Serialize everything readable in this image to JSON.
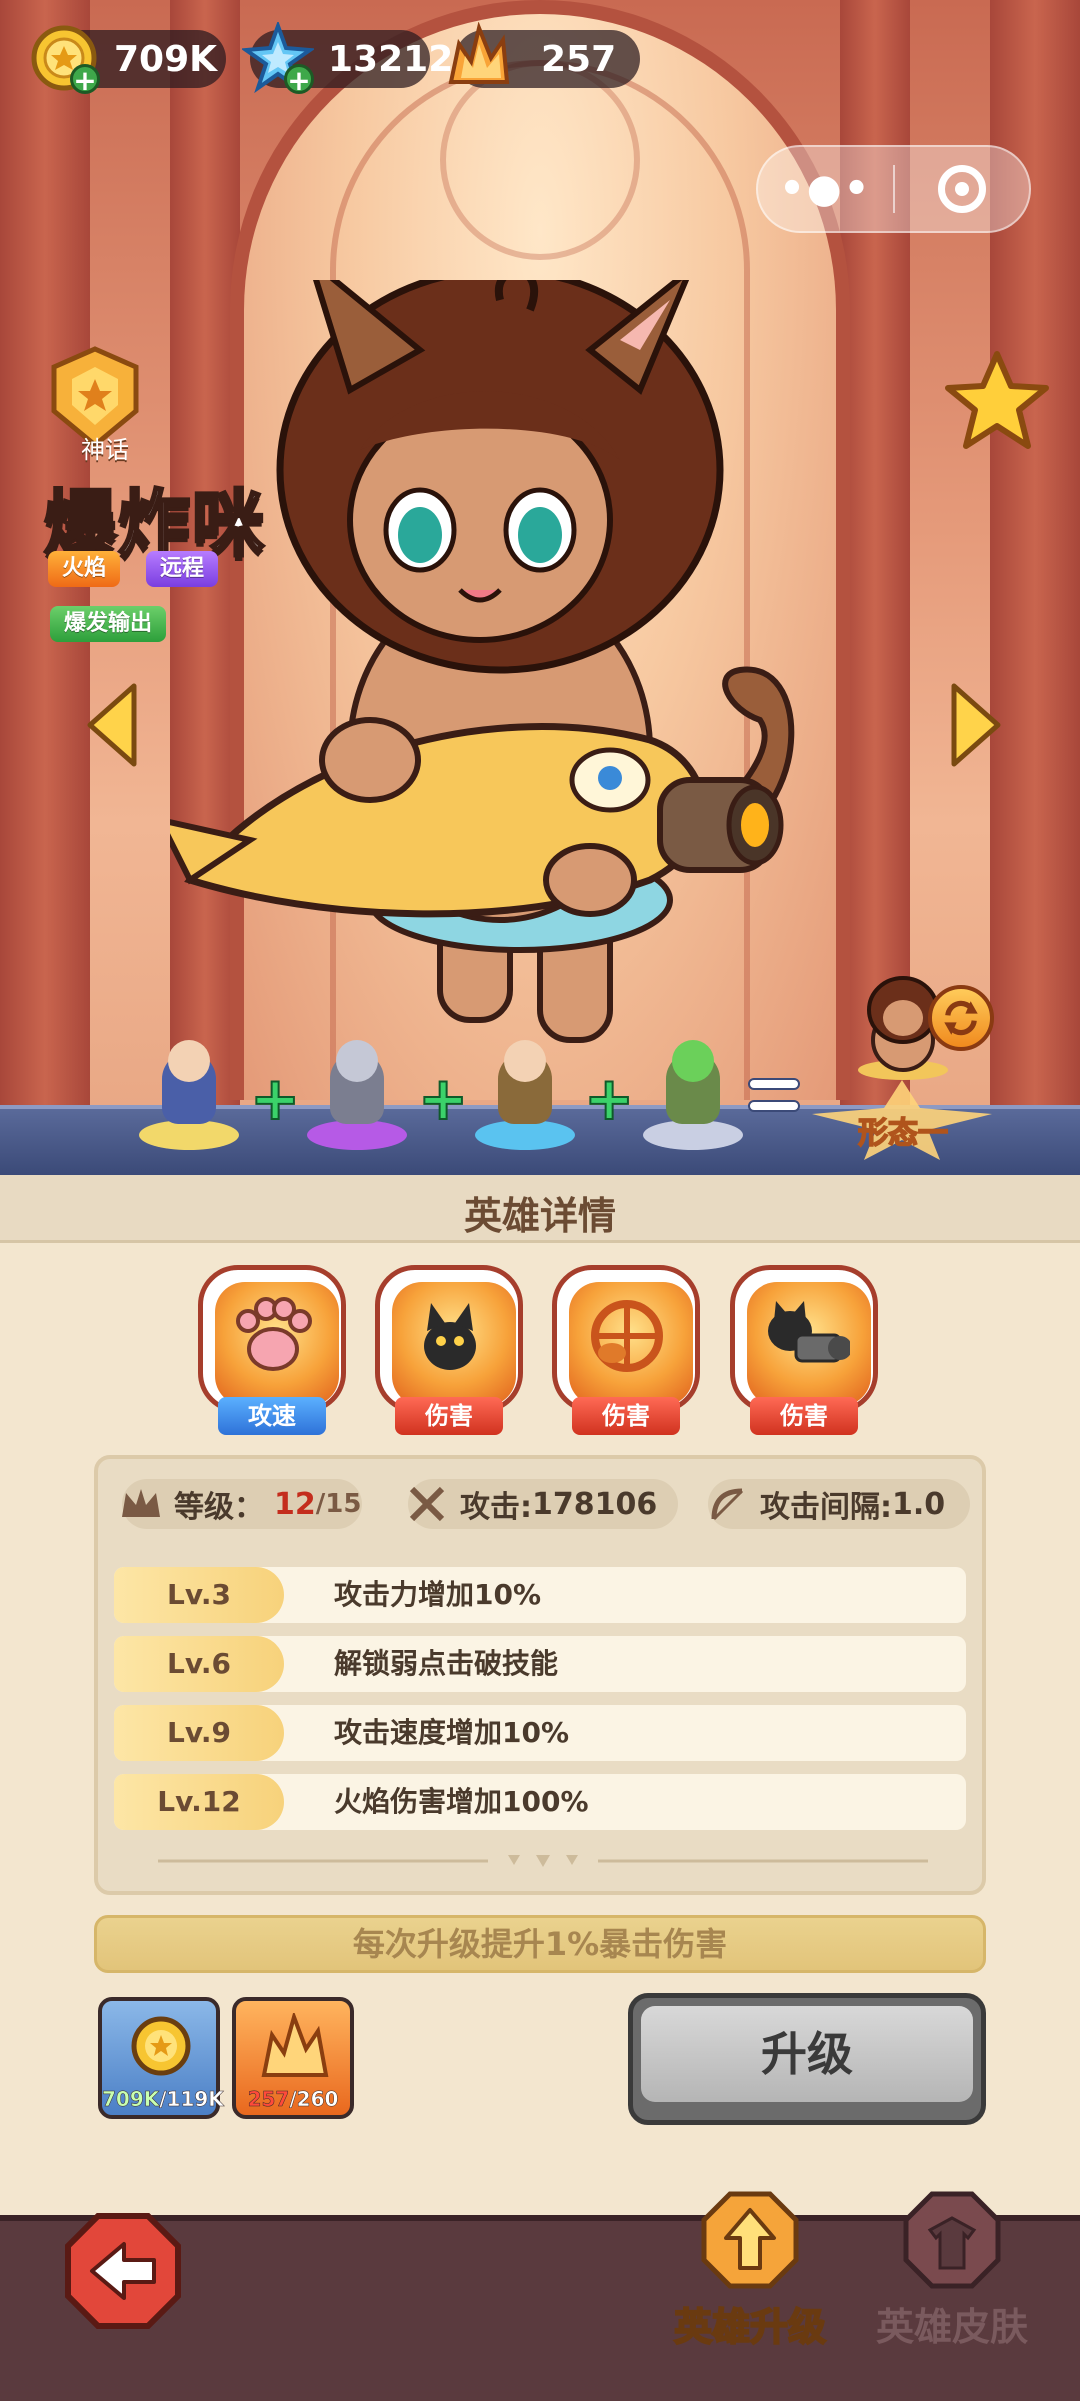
{
  "currencies": {
    "gold": "709K",
    "gems": "13212",
    "crystals": "257"
  },
  "hero": {
    "rarity": "神话",
    "name": "爆炸咪",
    "tags": [
      "火焰",
      "远程",
      "爆发输出"
    ]
  },
  "team": {
    "form_label": "形态一"
  },
  "details": {
    "title": "英雄详情",
    "skills": [
      {
        "icon": "paw-icon",
        "label": "攻速"
      },
      {
        "icon": "black-cat-icon",
        "label": "伤害"
      },
      {
        "icon": "fish-cannon-icon",
        "label": "伤害"
      },
      {
        "icon": "gatling-cat-icon",
        "label": "伤害"
      }
    ],
    "stats": {
      "level_label": "等级：",
      "level_current": "12",
      "level_max": "/15",
      "attack_label": "攻击: ",
      "attack_value": "178106",
      "interval_label": "攻击间隔: ",
      "interval_value": "1.0"
    },
    "level_bonuses": [
      {
        "level": "Lv.3",
        "desc": "攻击力增加10%"
      },
      {
        "level": "Lv.6",
        "desc": "解锁弱点击破技能"
      },
      {
        "level": "Lv.9",
        "desc": "攻击速度增加10%"
      },
      {
        "level": "Lv.12",
        "desc": "火焰伤害增加100%"
      }
    ],
    "crit_note": "每次升级提升1%暴击伤害"
  },
  "costs": {
    "gold_have": "709K",
    "gold_need": "/119K",
    "crystal_have": "257",
    "crystal_need": "/260"
  },
  "upgrade_label": "升级",
  "nav": {
    "upgrade": "英雄升级",
    "skin": "英雄皮肤"
  },
  "colors": {
    "accent_gold": "#ffd24a",
    "danger_red": "#c42d1d",
    "panel_bg": "#f3e6cf"
  }
}
